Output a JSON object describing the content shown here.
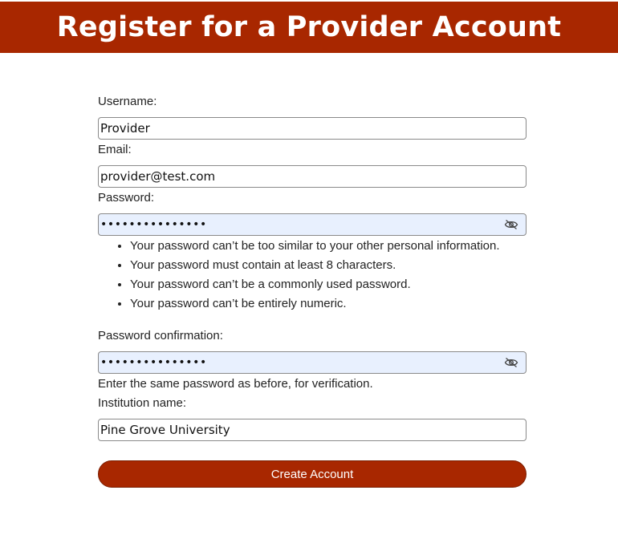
{
  "header": {
    "title": "Register for a Provider Account"
  },
  "form": {
    "username": {
      "label": "Username:",
      "value": "Provider"
    },
    "email": {
      "label": "Email:",
      "value": "provider@test.com"
    },
    "password": {
      "label": "Password:",
      "masked_value": "•••••••••••••••",
      "toggle_icon": "eye-slash-icon",
      "help": [
        "Your password can’t be too similar to your other personal information.",
        "Your password must contain at least 8 characters.",
        "Your password can’t be a commonly used password.",
        "Your password can’t be entirely numeric."
      ]
    },
    "password_confirmation": {
      "label": "Password confirmation:",
      "masked_value": "•••••••••••••••",
      "toggle_icon": "eye-slash-icon",
      "help": "Enter the same password as before, for verification."
    },
    "institution": {
      "label": "Institution name:",
      "value": "Pine Grove University"
    },
    "submit_label": "Create Account"
  },
  "colors": {
    "brand": "#a82700",
    "autofill_bg": "#e8f0fe",
    "field_border": "#8a8a8a"
  }
}
